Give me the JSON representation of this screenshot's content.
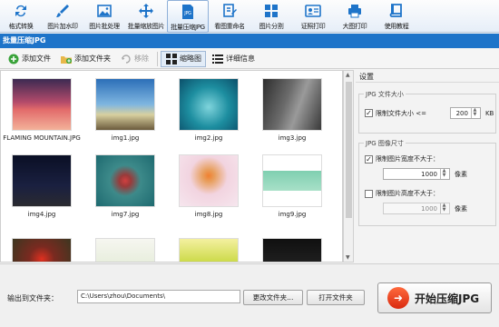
{
  "toolbar": {
    "items": [
      {
        "label": "格式转换",
        "icon": "convert-icon"
      },
      {
        "label": "图片加水印",
        "icon": "brush-icon"
      },
      {
        "label": "图片批处理",
        "icon": "image-icon"
      },
      {
        "label": "批量缩放图片",
        "icon": "resize-arrows-icon"
      },
      {
        "label": "批量压缩JPG",
        "icon": "jpg-file-icon",
        "active": true
      },
      {
        "label": "看图重命名",
        "icon": "rename-icon"
      },
      {
        "label": "图片分割",
        "icon": "grid-split-icon"
      },
      {
        "label": "证照打印",
        "icon": "id-card-icon"
      },
      {
        "label": "大图打印",
        "icon": "printer-icon"
      },
      {
        "label": "使用教程",
        "icon": "book-icon"
      }
    ]
  },
  "title": "批量压缩JPG",
  "subbar": {
    "add_file": "添加文件",
    "add_folder": "添加文件夹",
    "remove": "移除",
    "thumbnail": "缩略图",
    "details": "详细信息"
  },
  "thumbnails": [
    {
      "name": "FLAMING MOUNTAIN.JPG"
    },
    {
      "name": "img1.jpg"
    },
    {
      "name": "img2.jpg"
    },
    {
      "name": "img3.jpg"
    },
    {
      "name": "img4.jpg"
    },
    {
      "name": "img7.jpg"
    },
    {
      "name": "img8.jpg"
    },
    {
      "name": "img9.jpg"
    },
    {
      "name": ""
    },
    {
      "name": ""
    },
    {
      "name": ""
    },
    {
      "name": ""
    }
  ],
  "settings": {
    "header": "设置",
    "file_size_group": "JPG 文件大小",
    "limit_size_label": "限制文件大小 <=",
    "limit_size_value": "200",
    "limit_size_unit": "KB",
    "dimension_group": "JPG 图像尺寸",
    "limit_width_label": "限制图片宽度不大于：",
    "limit_width_value": "1000",
    "limit_width_unit": "像素",
    "limit_height_label": "限制图片高度不大于：",
    "limit_height_value": "1000",
    "limit_height_unit": "像素"
  },
  "bottom": {
    "output_label": "输出到文件夹：",
    "output_path": "C:\\Users\\zhou\\Documents\\",
    "change_folder": "更改文件夹...",
    "open_folder": "打开文件夹",
    "start": "开始压缩JPG"
  }
}
